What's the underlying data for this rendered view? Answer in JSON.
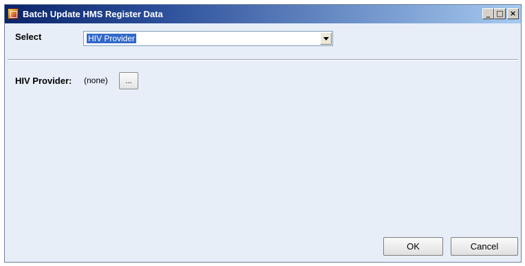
{
  "window": {
    "title": "Batch Update HMS Register Data",
    "controls": {
      "minimize": "_",
      "maximize": "□",
      "close": "×"
    }
  },
  "select_row": {
    "label": "Select",
    "value": "HIV Provider"
  },
  "field": {
    "label": "HIV Provider:",
    "value": "(none)",
    "browse_label": "..."
  },
  "buttons": {
    "ok": "OK",
    "cancel": "Cancel"
  },
  "icons": {
    "app": "app-icon",
    "dropdown": "chevron-down-icon"
  },
  "colors": {
    "titlebar_start": "#0a246a",
    "titlebar_end": "#a6caf0",
    "dialog_background": "#e7eef8",
    "selection": "#3168c9"
  }
}
